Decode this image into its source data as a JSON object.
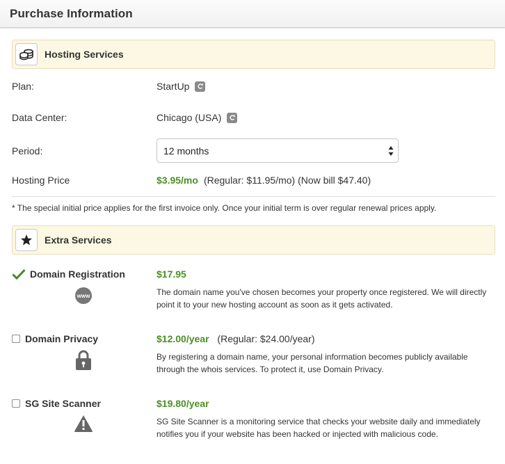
{
  "page": {
    "title": "Purchase Information"
  },
  "hosting": {
    "section_title": "Hosting Services",
    "plan_label": "Plan:",
    "plan_value": "StartUp",
    "datacenter_label": "Data Center:",
    "datacenter_value": "Chicago (USA)",
    "period_label": "Period:",
    "period_selected": "12 months",
    "price_label": "Hosting Price",
    "price_value": "$3.95/mo",
    "price_regular": "(Regular: $11.95/mo) (Now bill $47.40)",
    "footnote": "* The special initial price applies for the first invoice only. Once your initial term is over regular renewal prices apply."
  },
  "extras": {
    "section_title": "Extra Services",
    "items": [
      {
        "name": "Domain Registration",
        "checked": true,
        "icon": "www-icon",
        "price": "$17.95",
        "regular": "",
        "description": "The domain name you've chosen becomes your property once registered. We will directly point it to your new hosting account as soon as it gets activated."
      },
      {
        "name": "Domain Privacy",
        "checked": false,
        "icon": "lock-icon",
        "price": "$12.00/year",
        "regular": "(Regular: $24.00/year)",
        "description": "By registering a domain name, your personal information becomes publicly available through the whois services. To protect it, use Domain Privacy."
      },
      {
        "name": "SG Site Scanner",
        "checked": false,
        "icon": "warning-icon",
        "price": "$19.80/year",
        "regular": "",
        "description": "SG Site Scanner is a monitoring service that checks your website daily and immediately notifies you if your website has been hacked or injected with malicious code."
      }
    ]
  },
  "colors": {
    "price_green": "#4a8f23",
    "section_bg": "#fcf8e3",
    "check_green": "#3f8a2a"
  }
}
